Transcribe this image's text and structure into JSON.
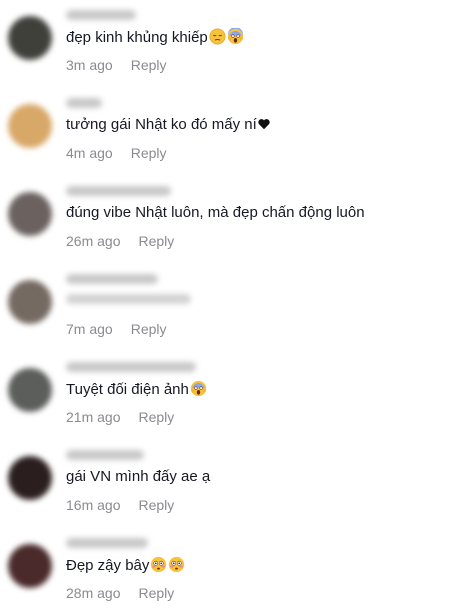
{
  "comments": [
    {
      "text": "đẹp kinh khủng khiếp",
      "emojis": [
        "pensive-face-icon",
        "screaming-face-icon"
      ],
      "time": "3m ago",
      "reply": "Reply",
      "avatar_color": "#3f403a"
    },
    {
      "text": "tưởng gái Nhật ko đó mấy ní",
      "emojis": [
        "black-heart-icon"
      ],
      "time": "4m ago",
      "reply": "Reply",
      "avatar_color": "#d8a868"
    },
    {
      "text": "đúng vibe Nhật luôn, mà đẹp chấn động luôn",
      "emojis": [],
      "time": "26m ago",
      "reply": "Reply",
      "avatar_color": "#6b625f"
    },
    {
      "text": "",
      "emojis": [],
      "time": "7m ago",
      "reply": "Reply",
      "avatar_color": "#756a62"
    },
    {
      "text": "Tuyệt đối điện ảnh",
      "emojis": [
        "screaming-face-icon"
      ],
      "time": "21m ago",
      "reply": "Reply",
      "avatar_color": "#5c5e5c"
    },
    {
      "text": "gái VN mình đấy ae ạ",
      "emojis": [],
      "time": "16m ago",
      "reply": "Reply",
      "avatar_color": "#2a1f1e"
    },
    {
      "text": "Đẹp zậy bây",
      "emojis": [
        "flushed-face-icon",
        "flushed-face-icon"
      ],
      "time": "28m ago",
      "reply": "Reply",
      "avatar_color": "#4a2a2b"
    }
  ]
}
